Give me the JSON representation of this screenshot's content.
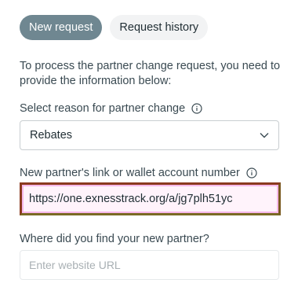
{
  "tabs": [
    {
      "label": "New request",
      "active": true
    },
    {
      "label": "Request history",
      "active": false
    }
  ],
  "intro_text": "To process the partner change request, you need to provide the information below:",
  "reason": {
    "label": "Select reason for partner change",
    "selected_value": "Rebates",
    "icon": "info-icon"
  },
  "partner_link": {
    "label": "New partner's link or wallet account number",
    "value": "https://one.exnesstrack.org/a/jg7plh51yc",
    "icon": "info-icon"
  },
  "source": {
    "label": "Where did you find your new partner?",
    "placeholder": "Enter website URL"
  },
  "colors": {
    "accent": "#6f8791",
    "highlight_border": "#8b3a1f",
    "highlight_inner": "#f6b8ea"
  }
}
